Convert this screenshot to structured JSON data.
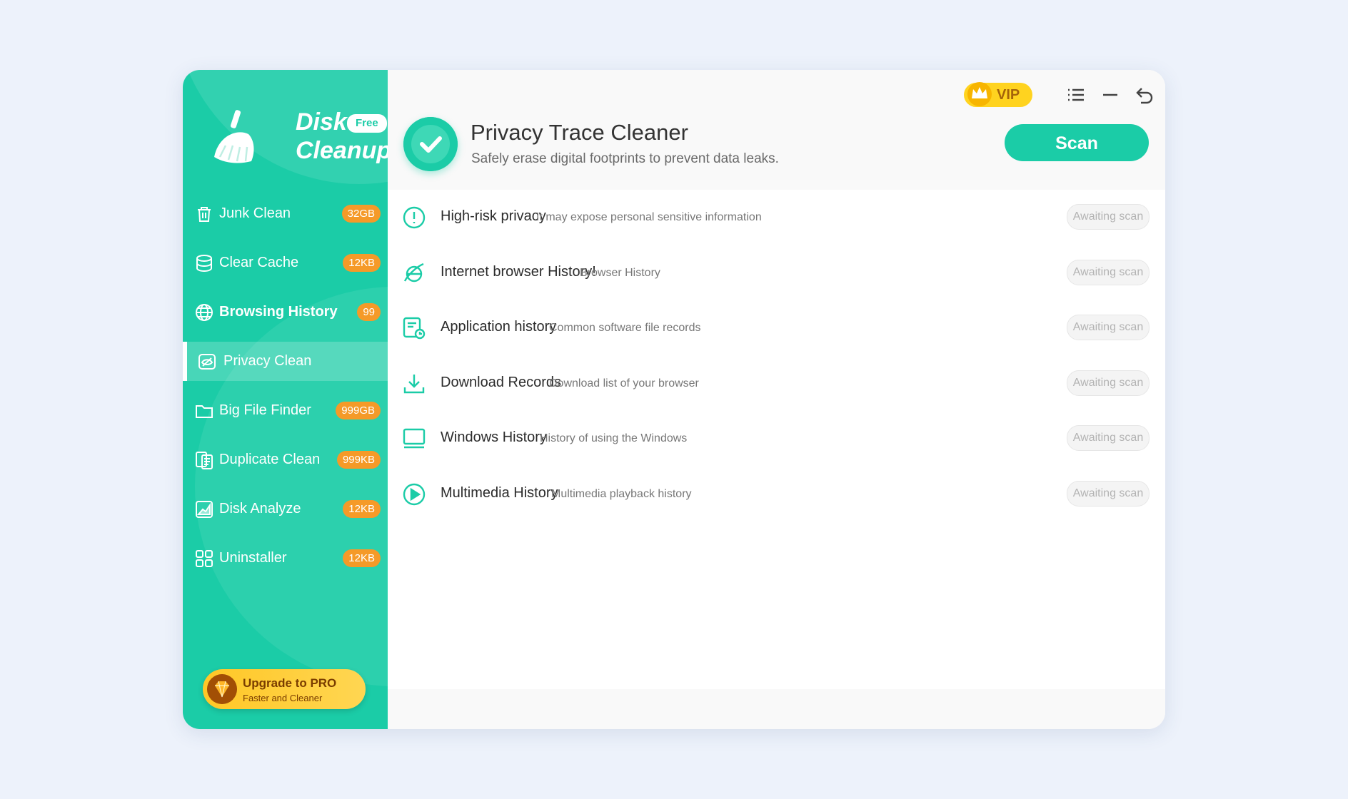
{
  "app": {
    "name_line1": "Disk",
    "name_line2": "Cleanup",
    "edition": "Free"
  },
  "sidebar": {
    "items": [
      {
        "label": "Junk Clean",
        "badge": "32GB",
        "icon": "trash-icon"
      },
      {
        "label": "Clear Cache",
        "badge": "12KB",
        "icon": "database-icon"
      },
      {
        "label": "Browsing History",
        "badge": "99",
        "icon": "globe-icon"
      },
      {
        "label": "Privacy Clean",
        "badge": "",
        "icon": "privacy-eye-icon",
        "active": true
      },
      {
        "label": "Big File Finder",
        "badge": "999GB",
        "icon": "folder-icon"
      },
      {
        "label": "Duplicate Clean",
        "badge": "999KB",
        "icon": "duplicate-file-icon"
      },
      {
        "label": "Disk Analyze",
        "badge": "12KB",
        "icon": "chart-icon"
      },
      {
        "label": "Uninstaller",
        "badge": "12KB",
        "icon": "apps-grid-icon"
      }
    ],
    "upgrade": {
      "title": "Upgrade to PRO",
      "subtitle": "Faster and Cleaner"
    }
  },
  "header": {
    "vip_label": "VIP",
    "title": "Privacy Trace Cleaner",
    "subtitle": "Safely erase digital footprints to prevent data leaks.",
    "scan_label": "Scan"
  },
  "rows": [
    {
      "title": "High-risk privacy",
      "desc": "It may expose personal sensitive information",
      "status": "Awaiting scan",
      "icon": "alert-circle-icon"
    },
    {
      "title": "Internet browser History!",
      "desc": "Browser History",
      "status": "Awaiting scan",
      "icon": "browser-icon"
    },
    {
      "title": "Application history",
      "desc": "Common software file records",
      "status": "Awaiting scan",
      "icon": "app-history-icon"
    },
    {
      "title": "Download Records",
      "desc": "Download list of your browser",
      "status": "Awaiting scan",
      "icon": "download-icon"
    },
    {
      "title": "Windows History",
      "desc": "History of using the Windows",
      "status": "Awaiting scan",
      "icon": "monitor-icon"
    },
    {
      "title": "Multimedia History",
      "desc": "Multimedia playback history",
      "status": "Awaiting scan",
      "icon": "play-circle-icon"
    }
  ],
  "colors": {
    "accent": "#1bcca7",
    "badge": "#f59a28",
    "vip": "#ffd31f"
  }
}
